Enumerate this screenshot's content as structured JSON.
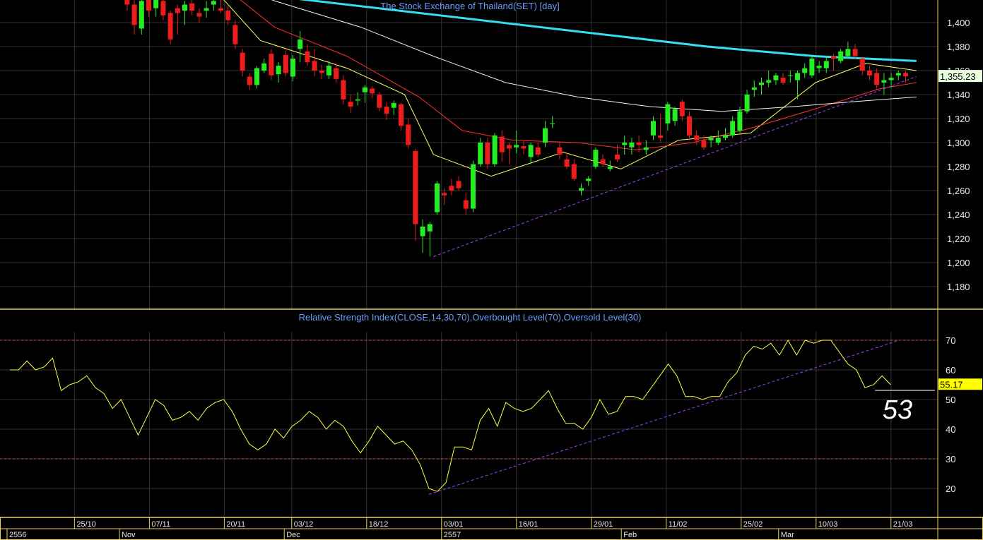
{
  "colors": {
    "background": "#000000",
    "grid": "#333333",
    "panel_border": "#e8d060",
    "text": "#e8e8e8",
    "title": "#6a9cff",
    "up_candle": "#22ee22",
    "down_candle": "#ee1c1c",
    "ma_fast": "#ffff60",
    "ma_mid": "#ff3030",
    "ma_slow": "#f0f0f0",
    "ma_long": "#33e0f0",
    "rsi_line": "#ffff40",
    "trend_line": "#a040ff",
    "price_tag_bg": "#e8ffe0",
    "rsi_tag_bg": "#ffff00"
  },
  "chart_data": [
    {
      "type": "candlestick",
      "title": "The Stock Exchange of Thailand(SET) [day]",
      "ylim": [
        1160,
        1420
      ],
      "y_ticks": [
        "1,180",
        "1,200",
        "1,220",
        "1,240",
        "1,260",
        "1,280",
        "1,300",
        "1,320",
        "1,340",
        "1,360",
        "1,380",
        "1,400"
      ],
      "last_price_label": "1,355.23",
      "candles": [
        [
          1445,
          1460,
          1410,
          1415
        ],
        [
          1415,
          1430,
          1390,
          1398
        ],
        [
          1395,
          1422,
          1390,
          1418
        ],
        [
          1420,
          1424,
          1405,
          1410
        ],
        [
          1412,
          1430,
          1405,
          1425
        ],
        [
          1418,
          1420,
          1402,
          1406
        ],
        [
          1408,
          1410,
          1382,
          1386
        ],
        [
          1412,
          1415,
          1390,
          1408
        ],
        [
          1410,
          1418,
          1398,
          1415
        ],
        [
          1416,
          1420,
          1406,
          1410
        ],
        [
          1408,
          1412,
          1400,
          1405
        ],
        [
          1410,
          1418,
          1404,
          1412
        ],
        [
          1415,
          1422,
          1410,
          1418
        ],
        [
          1412,
          1420,
          1408,
          1410
        ],
        [
          1410,
          1414,
          1398,
          1402
        ],
        [
          1398,
          1402,
          1378,
          1382
        ],
        [
          1375,
          1378,
          1355,
          1360
        ],
        [
          1355,
          1358,
          1344,
          1348
        ],
        [
          1348,
          1364,
          1345,
          1362
        ],
        [
          1360,
          1370,
          1358,
          1366
        ],
        [
          1374,
          1378,
          1352,
          1356
        ],
        [
          1357,
          1367,
          1350,
          1364
        ],
        [
          1373,
          1377,
          1355,
          1358
        ],
        [
          1355,
          1373,
          1351,
          1370
        ],
        [
          1378,
          1393,
          1367,
          1386
        ],
        [
          1376,
          1382,
          1364,
          1367
        ],
        [
          1368,
          1378,
          1355,
          1360
        ],
        [
          1360,
          1365,
          1353,
          1358
        ],
        [
          1356,
          1368,
          1353,
          1364
        ],
        [
          1362,
          1366,
          1350,
          1353
        ],
        [
          1352,
          1356,
          1332,
          1336
        ],
        [
          1334,
          1340,
          1325,
          1330
        ],
        [
          1335,
          1342,
          1331,
          1336
        ],
        [
          1342,
          1348,
          1333,
          1346
        ],
        [
          1345,
          1347,
          1337,
          1341
        ],
        [
          1340,
          1342,
          1326,
          1329
        ],
        [
          1330,
          1334,
          1319,
          1324
        ],
        [
          1329,
          1335,
          1323,
          1333
        ],
        [
          1332,
          1333,
          1310,
          1314
        ],
        [
          1315,
          1320,
          1295,
          1298
        ],
        [
          1293,
          1295,
          1218,
          1232
        ],
        [
          1222,
          1236,
          1208,
          1230
        ],
        [
          1226,
          1234,
          1205,
          1232
        ],
        [
          1242,
          1268,
          1240,
          1266
        ],
        [
          1258,
          1262,
          1248,
          1256
        ],
        [
          1264,
          1270,
          1256,
          1260
        ],
        [
          1268,
          1272,
          1260,
          1262
        ],
        [
          1252,
          1258,
          1240,
          1245
        ],
        [
          1245,
          1285,
          1242,
          1282
        ],
        [
          1282,
          1304,
          1280,
          1300
        ],
        [
          1300,
          1304,
          1278,
          1282
        ],
        [
          1282,
          1308,
          1280,
          1306
        ],
        [
          1305,
          1310,
          1284,
          1292
        ],
        [
          1298,
          1300,
          1282,
          1295
        ],
        [
          1296,
          1310,
          1291,
          1298
        ],
        [
          1297,
          1302,
          1290,
          1295
        ],
        [
          1288,
          1300,
          1282,
          1298
        ],
        [
          1296,
          1300,
          1288,
          1290
        ],
        [
          1300,
          1318,
          1296,
          1312
        ],
        [
          1316,
          1322,
          1312,
          1316
        ],
        [
          1296,
          1300,
          1286,
          1290
        ],
        [
          1286,
          1292,
          1278,
          1280
        ],
        [
          1282,
          1286,
          1268,
          1270
        ],
        [
          1260,
          1266,
          1256,
          1262
        ],
        [
          1268,
          1272,
          1264,
          1270
        ],
        [
          1280,
          1296,
          1278,
          1294
        ],
        [
          1286,
          1290,
          1280,
          1282
        ],
        [
          1278,
          1285,
          1276,
          1280
        ],
        [
          1290,
          1298,
          1284,
          1286
        ],
        [
          1298,
          1306,
          1290,
          1300
        ],
        [
          1296,
          1304,
          1290,
          1300
        ],
        [
          1300,
          1306,
          1292,
          1298
        ],
        [
          1294,
          1302,
          1290,
          1296
        ],
        [
          1306,
          1322,
          1302,
          1318
        ],
        [
          1306,
          1324,
          1300,
          1304
        ],
        [
          1316,
          1334,
          1310,
          1332
        ],
        [
          1318,
          1330,
          1314,
          1328
        ],
        [
          1334,
          1336,
          1318,
          1322
        ],
        [
          1322,
          1326,
          1302,
          1306
        ],
        [
          1306,
          1310,
          1298,
          1302
        ],
        [
          1302,
          1306,
          1294,
          1296
        ],
        [
          1302,
          1306,
          1296,
          1304
        ],
        [
          1300,
          1310,
          1298,
          1304
        ],
        [
          1304,
          1312,
          1302,
          1306
        ],
        [
          1306,
          1322,
          1304,
          1318
        ],
        [
          1310,
          1330,
          1308,
          1326
        ],
        [
          1326,
          1344,
          1324,
          1340
        ],
        [
          1344,
          1352,
          1338,
          1346
        ],
        [
          1348,
          1354,
          1340,
          1350
        ],
        [
          1350,
          1360,
          1346,
          1352
        ],
        [
          1352,
          1358,
          1348,
          1356
        ],
        [
          1354,
          1358,
          1348,
          1350
        ],
        [
          1356,
          1360,
          1350,
          1356
        ],
        [
          1352,
          1360,
          1336,
          1358
        ],
        [
          1358,
          1366,
          1354,
          1362
        ],
        [
          1356,
          1372,
          1354,
          1370
        ],
        [
          1362,
          1368,
          1358,
          1364
        ],
        [
          1362,
          1372,
          1358,
          1368
        ],
        [
          1372,
          1374,
          1360,
          1370
        ],
        [
          1368,
          1378,
          1366,
          1376
        ],
        [
          1372,
          1384,
          1370,
          1378
        ],
        [
          1378,
          1382,
          1370,
          1372
        ],
        [
          1370,
          1372,
          1356,
          1360
        ],
        [
          1360,
          1364,
          1352,
          1356
        ],
        [
          1358,
          1362,
          1344,
          1348
        ],
        [
          1350,
          1358,
          1340,
          1352
        ],
        [
          1352,
          1358,
          1346,
          1354
        ],
        [
          1356,
          1360,
          1352,
          1358
        ],
        [
          1358,
          1360,
          1350,
          1355.23
        ]
      ],
      "moving_averages": [
        {
          "name": "MA fast",
          "color": "#ffff60",
          "points": [
            [
              1,
              1440
            ],
            [
              12,
              1425
            ],
            [
              18,
              1385
            ],
            [
              30,
              1362
            ],
            [
              38,
              1340
            ],
            [
              42,
              1290
            ],
            [
              50,
              1272
            ],
            [
              60,
              1292
            ],
            [
              68,
              1278
            ],
            [
              76,
              1302
            ],
            [
              86,
              1308
            ],
            [
              95,
              1350
            ],
            [
              102,
              1366
            ],
            [
              109,
              1360
            ]
          ]
        },
        {
          "name": "MA mid",
          "color": "#ff3030",
          "points": [
            [
              1,
              1446
            ],
            [
              15,
              1420
            ],
            [
              20,
              1396
            ],
            [
              30,
              1372
            ],
            [
              40,
              1338
            ],
            [
              46,
              1310
            ],
            [
              53,
              1302
            ],
            [
              62,
              1300
            ],
            [
              70,
              1294
            ],
            [
              78,
              1300
            ],
            [
              86,
              1312
            ],
            [
              96,
              1330
            ],
            [
              104,
              1345
            ],
            [
              109,
              1350
            ]
          ]
        },
        {
          "name": "MA slow",
          "color": "#f0f0f0",
          "points": [
            [
              1,
              1452
            ],
            [
              10,
              1440
            ],
            [
              20,
              1418
            ],
            [
              32,
              1396
            ],
            [
              42,
              1372
            ],
            [
              52,
              1350
            ],
            [
              62,
              1338
            ],
            [
              72,
              1330
            ],
            [
              82,
              1326
            ],
            [
              92,
              1330
            ],
            [
              100,
              1334
            ],
            [
              109,
              1338
            ]
          ]
        },
        {
          "name": "MA long",
          "color": "#33e0f0",
          "points": [
            [
              1,
              1430
            ],
            [
              20,
              1422
            ],
            [
              40,
              1408
            ],
            [
              60,
              1394
            ],
            [
              80,
              1380
            ],
            [
              95,
              1372
            ],
            [
              109,
              1368
            ]
          ]
        }
      ],
      "trend_line": [
        [
          42,
          1205
        ],
        [
          109,
          1355
        ]
      ]
    },
    {
      "type": "line",
      "title": "Relative Strength Index(CLOSE,14,30,70),Overbought Level(70),Oversold Level(30)",
      "ylim": [
        12,
        75
      ],
      "y_ticks": [
        "20",
        "30",
        "40",
        "50",
        "60",
        "70"
      ],
      "overbought": 70,
      "oversold": 30,
      "last_value_label": "55.17",
      "annotation": "53",
      "rsi": [
        60,
        60,
        63,
        60,
        61,
        64,
        53,
        55,
        56,
        58,
        54,
        52,
        47,
        50,
        44,
        38,
        44,
        50,
        48,
        43,
        44,
        46,
        43,
        47,
        49,
        50,
        46,
        40,
        35,
        33,
        35,
        40,
        37,
        41,
        43,
        46,
        44,
        40,
        43,
        41,
        36,
        32,
        36,
        41,
        38,
        35,
        36,
        33,
        28,
        20,
        19,
        22,
        34,
        34,
        33,
        43,
        47,
        41,
        49,
        47,
        46,
        47,
        50,
        53,
        47,
        42,
        42,
        40,
        44,
        50,
        45,
        46,
        51,
        51,
        50,
        54,
        58,
        62,
        58,
        51,
        51,
        50,
        51,
        51,
        56,
        59,
        65,
        68,
        67,
        69,
        65,
        70,
        65,
        70,
        69,
        70,
        70,
        66,
        62,
        60,
        54,
        55,
        58,
        55
      ],
      "trend_line": [
        [
          49,
          18
        ],
        [
          104,
          70
        ]
      ]
    }
  ],
  "x_axis": {
    "date_labels": [
      {
        "index": 9,
        "text": "25/10"
      },
      {
        "index": 19,
        "text": "07/11"
      },
      {
        "index": 29,
        "text": "20/11"
      },
      {
        "index": 38,
        "text": "03/12"
      },
      {
        "index": 48,
        "text": "18/12"
      },
      {
        "index": 58,
        "text": "03/01"
      },
      {
        "index": 68,
        "text": "16/01"
      },
      {
        "index": 78,
        "text": "29/01"
      },
      {
        "index": 88,
        "text": "11/02"
      },
      {
        "index": 98,
        "text": "25/02"
      },
      {
        "index": 108,
        "text": "10/03"
      },
      {
        "index": 118,
        "text": "21/03"
      }
    ],
    "month_labels": [
      {
        "index": 0,
        "text": "2556"
      },
      {
        "index": 15,
        "text": "Nov"
      },
      {
        "index": 37,
        "text": "Dec"
      },
      {
        "index": 58,
        "text": "2557"
      },
      {
        "index": 82,
        "text": "Feb"
      },
      {
        "index": 103,
        "text": "Mar"
      }
    ]
  }
}
